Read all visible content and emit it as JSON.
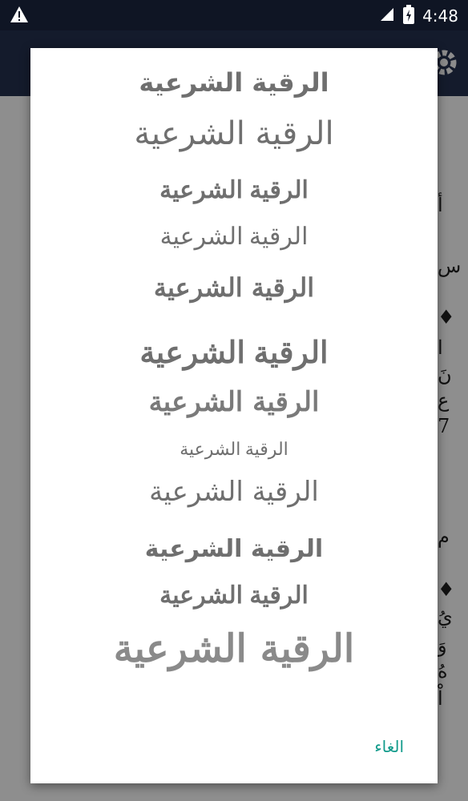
{
  "status_bar": {
    "time": "4:48"
  },
  "dialog": {
    "font_options": [
      "الرقية الشرعية",
      "الرقية الشرعية",
      "الرقية الشرعية",
      "الرقية الشرعية",
      "الرقية الشرعية",
      "الرقية الشرعية",
      "الرقية الشرعية",
      "الرقية الشرعية",
      "الرقية الشرعية",
      "الرقية الشرعية",
      "الرقية الشرعية",
      "الرقية الشرعية"
    ],
    "cancel_label": "الغاء"
  },
  "background_fragments": [
    "أ",
    "س",
    "♦",
    "ا",
    "نَ",
    "ع",
    "7",
    "م",
    "♦",
    "يُ",
    "وَ",
    "هُ",
    "اْ"
  ],
  "colors": {
    "status_bar": "#0f1524",
    "app_bar": "#141b2c",
    "scrim": "#8e8e8e",
    "option_text": "#6f6f6f",
    "accent": "#129b8b"
  }
}
